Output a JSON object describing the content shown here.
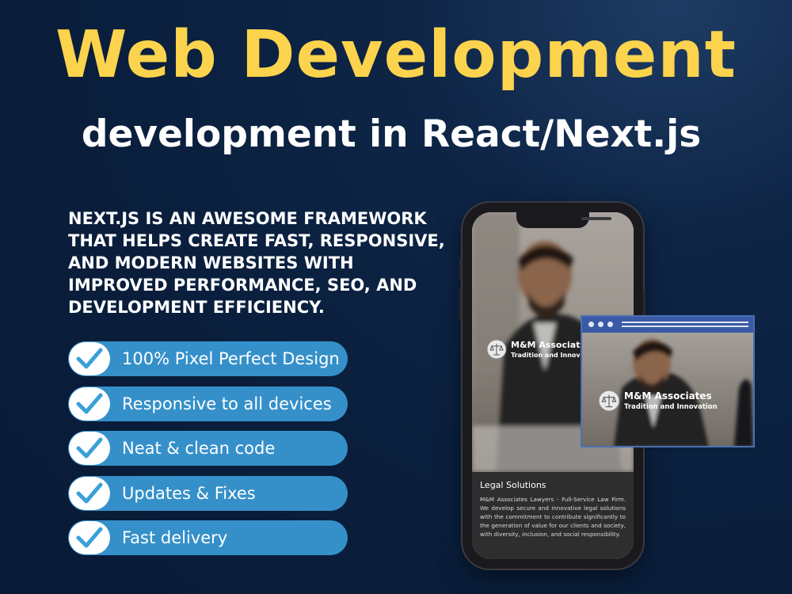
{
  "title": "Web Development",
  "subtitle": "development in React/Next.js",
  "blurb": "NEXT.JS IS AN AWESOME FRAMEWORK THAT HELPS CREATE FAST, RESPONSIVE, AND MODERN WEBSITES WITH IMPROVED PERFORMANCE, SEO, AND DEVELOPMENT EFFICIENCY.",
  "features": [
    {
      "label": "100% Pixel Perfect Design",
      "icon": "check-icon"
    },
    {
      "label": "Responsive to all devices",
      "icon": "check-icon"
    },
    {
      "label": "Neat & clean code",
      "icon": "check-icon"
    },
    {
      "label": "Updates & Fixes",
      "icon": "check-icon"
    },
    {
      "label": "Fast delivery",
      "icon": "check-icon"
    }
  ],
  "mockup": {
    "brand_name": "M&M Associates",
    "brand_tagline": "Tradition and Innovation",
    "section_title": "Legal Solutions",
    "section_text": "M&M Associates Lawyers - Full-Service Law Firm. We develop secure and innovative legal solutions with the commitment to contribute significantly to the generation of value for our clients and society, with diversity, inclusion, and social responsibility."
  },
  "colors": {
    "background": "#0a1f3d",
    "title": "#fcd34d",
    "pill": "#3590c9",
    "check": "#3aa0d8",
    "browser_frame": "#3b5aa6"
  }
}
